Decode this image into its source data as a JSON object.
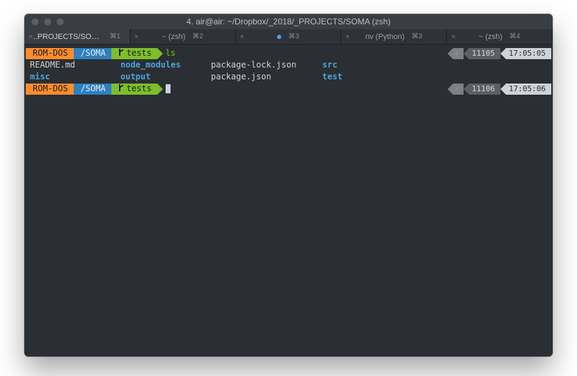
{
  "window": {
    "title": "4. air@air: ~/Dropbox/_2018/_PROJECTS/SOMA (zsh)"
  },
  "tabs": [
    {
      "label": "..PROJECTS/SOMA (…",
      "shortcut": "⌘1",
      "active": true,
      "dot": false
    },
    {
      "label": "~ (zsh)",
      "shortcut": "⌘2",
      "active": false,
      "dot": false
    },
    {
      "label": "",
      "shortcut": "⌘3",
      "active": false,
      "dot": true
    },
    {
      "label": "nv (Python)",
      "shortcut": "⌘3",
      "active": false,
      "dot": false
    },
    {
      "label": "~ (zsh)",
      "shortcut": "⌘4",
      "active": false,
      "dot": false
    }
  ],
  "prompt": {
    "user": "ROM-DOS",
    "path": "/SOMA",
    "branch": "tests"
  },
  "lines": [
    {
      "cmd": "ls",
      "num": "11105",
      "time": "17:05:05"
    },
    {
      "cmd": "",
      "num": "11106",
      "time": "17:05:06"
    }
  ],
  "ls": {
    "row0": {
      "c0": "README.md",
      "c1": "node_modules",
      "c2": "package-lock.json",
      "c3": "src"
    },
    "row1": {
      "c0": "misc",
      "c1": "output",
      "c2": "package.json",
      "c3": "test"
    }
  },
  "icons": {
    "check": "✓",
    "close": "×"
  }
}
